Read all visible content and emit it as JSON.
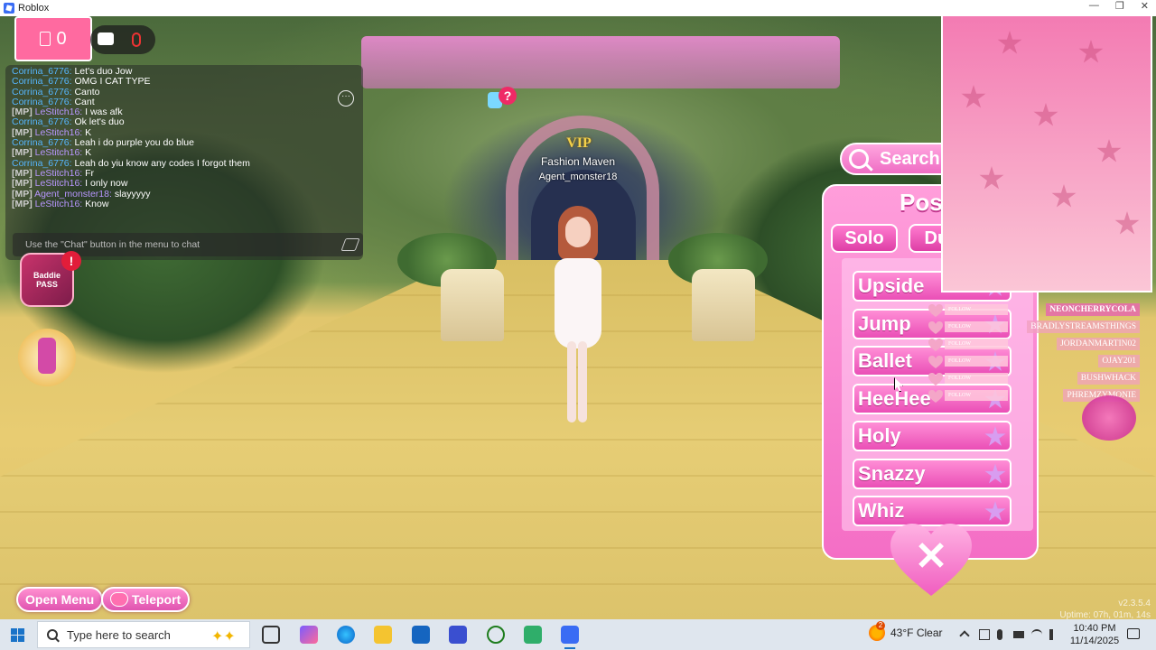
{
  "window": {
    "title": "Roblox",
    "minimize_glyph": "—",
    "restore_glyph": "❐",
    "close_glyph": "✕"
  },
  "hud": {
    "coins": "0",
    "vip_label": "VIP",
    "player_title": "Fashion Maven",
    "player_name": "Agent_monster18",
    "top_emote_badge": "?"
  },
  "chat": {
    "more_glyph": "···",
    "placeholder": "Use the \"Chat\" button in the menu to chat",
    "messages": [
      {
        "tag": "",
        "user": "Corrina_6776:",
        "msg": "Let's duo Jow",
        "variant": "corrina"
      },
      {
        "tag": "",
        "user": "Corrina_6776:",
        "msg": "OMG I CAT TYPE",
        "variant": "corrina"
      },
      {
        "tag": "",
        "user": "Corrina_6776:",
        "msg": "Canto",
        "variant": "corrina"
      },
      {
        "tag": "",
        "user": "Corrina_6776:",
        "msg": "Cant",
        "variant": "corrina"
      },
      {
        "tag": "[MP]",
        "user": "LeStitch16:",
        "msg": "I was afk",
        "variant": "stitch"
      },
      {
        "tag": "",
        "user": "Corrina_6776:",
        "msg": "Ok let's duo",
        "variant": "corrina"
      },
      {
        "tag": "[MP]",
        "user": "LeStitch16:",
        "msg": "K",
        "variant": "stitch"
      },
      {
        "tag": "",
        "user": "Corrina_6776:",
        "msg": "Leah i do purple you do blue",
        "variant": "corrina"
      },
      {
        "tag": "[MP]",
        "user": "LeStitch16:",
        "msg": "K",
        "variant": "stitch"
      },
      {
        "tag": "",
        "user": "Corrina_6776:",
        "msg": "Leah do yiu know any codes I forgot them",
        "variant": "corrina"
      },
      {
        "tag": "[MP]",
        "user": "LeStitch16:",
        "msg": "Fr",
        "variant": "stitch"
      },
      {
        "tag": "[MP]",
        "user": "LeStitch16:",
        "msg": "I only now",
        "variant": "stitch"
      },
      {
        "tag": "[MP]",
        "user": "Agent_monster18:",
        "msg": "slayyyyy",
        "variant": "stitch"
      },
      {
        "tag": "[MP]",
        "user": "LeStitch16:",
        "msg": "Know",
        "variant": "stitch"
      }
    ]
  },
  "side_icons": {
    "pass_label": "Baddie PASS",
    "pass_badge": "!"
  },
  "bottom_buttons": {
    "open_menu": "Open Menu",
    "teleport": "Teleport"
  },
  "poses": {
    "search_label": "Search",
    "title": "Poses",
    "tabs": [
      "Solo",
      "Duo"
    ],
    "items": [
      "Upside",
      "Jump",
      "Ballet",
      "HeeHee",
      "Holy",
      "Snazzy",
      "Whiz"
    ],
    "close_glyph": "✕"
  },
  "leaderboard": {
    "follow_label": "FOLLOW",
    "names": [
      "NEONCHERRYCOLA",
      "BRADLYSTREAMSTHINGS",
      "JORDANMARTIN02",
      "OJAY201",
      "BUSHWHACK",
      "PHREMZYMONIE"
    ]
  },
  "version": {
    "build": "v2.3.5.4",
    "uptime": "Uptime: 07h, 01m, 14s"
  },
  "taskbar": {
    "search_placeholder": "Type here to search",
    "weather_temp": "43°F",
    "weather_cond": "Clear",
    "weather_badge": "2",
    "time": "10:40 PM",
    "date": "11/14/2025"
  }
}
